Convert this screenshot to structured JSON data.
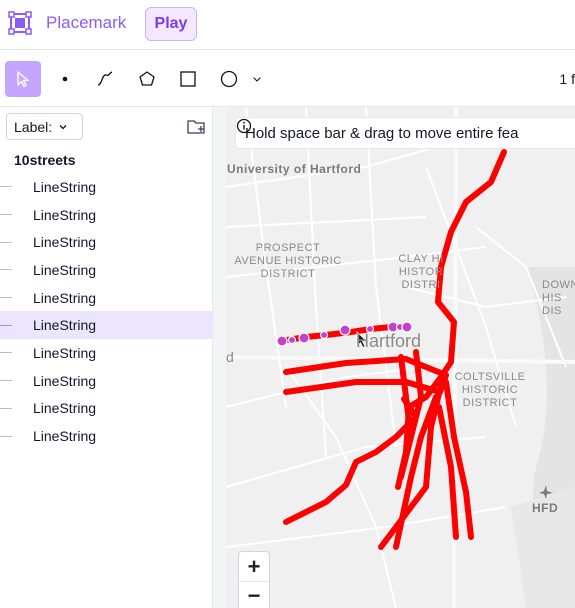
{
  "app": {
    "title": "Placemark",
    "play_label": "Play"
  },
  "toolbar": {
    "tools": [
      {
        "name": "select-tool",
        "icon": "cursor-icon",
        "active": true
      },
      {
        "name": "point-tool",
        "icon": "point-icon"
      },
      {
        "name": "line-tool",
        "icon": "line-icon"
      },
      {
        "name": "polygon-tool",
        "icon": "polygon-icon"
      },
      {
        "name": "rectangle-tool",
        "icon": "rectangle-icon"
      },
      {
        "name": "circle-tool",
        "icon": "circle-icon"
      }
    ],
    "page_indicator": "1 f"
  },
  "sidebar": {
    "label_button": "Label:",
    "group_name": "10streets",
    "features": [
      {
        "label": "LineString",
        "selected": false
      },
      {
        "label": "LineString",
        "selected": false
      },
      {
        "label": "LineString",
        "selected": false
      },
      {
        "label": "LineString",
        "selected": false
      },
      {
        "label": "LineString",
        "selected": false
      },
      {
        "label": "LineString",
        "selected": true
      },
      {
        "label": "LineString",
        "selected": false
      },
      {
        "label": "LineString",
        "selected": false
      },
      {
        "label": "LineString",
        "selected": false
      },
      {
        "label": "LineString",
        "selected": false
      }
    ]
  },
  "map": {
    "hint": "Hold space bar & drag to move entire fea",
    "labels": {
      "university": "University of Hartford",
      "prospect": "PROSPECT\nAVENUE HISTORIC\nDISTRICT",
      "clay_hill": "CLAY HI\nHISTOR\nDISTRI",
      "downtown": "DOWN\nHIS\nDIS",
      "hartford": "Hartford",
      "coltsville": "COLTSVILLE\nHISTORIC\nDISTRICT",
      "airport": "HFD",
      "edge_d": "d"
    },
    "zoom_in": "+",
    "zoom_out": "−",
    "line_color": "#ff0000",
    "vertex_color": "#c640c9"
  }
}
